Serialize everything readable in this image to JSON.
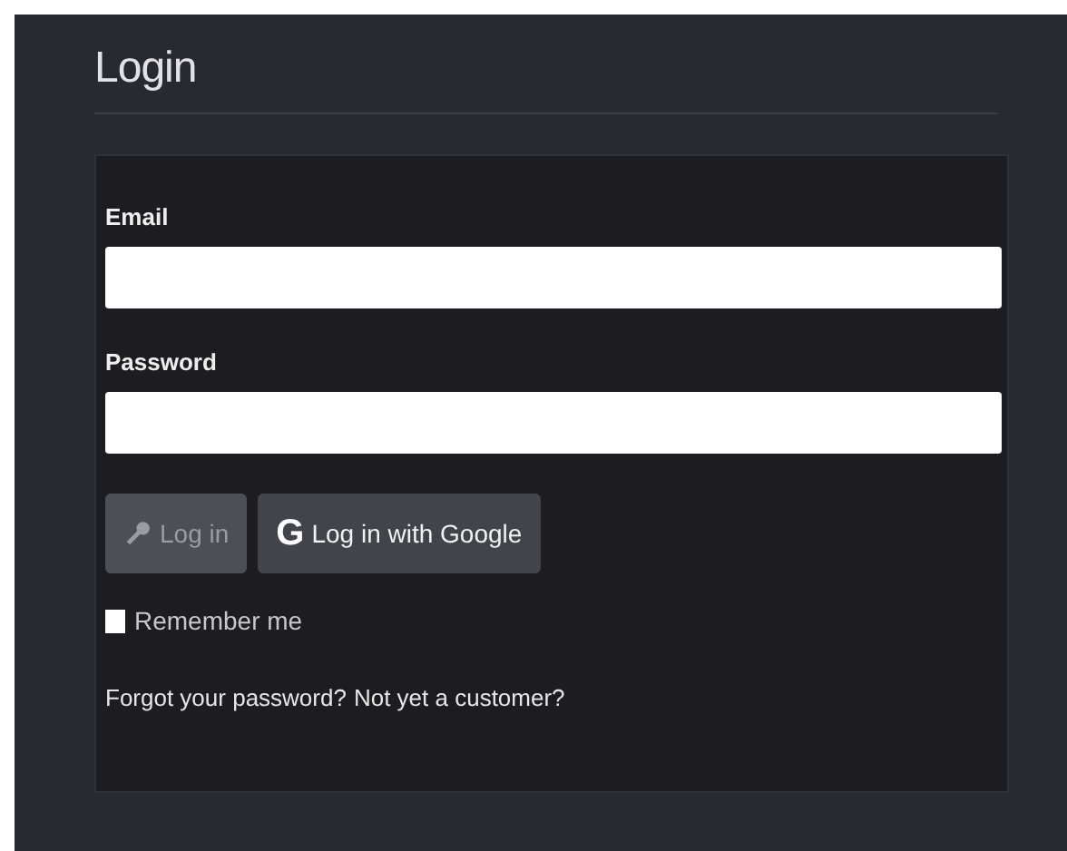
{
  "title": "Login",
  "fields": [
    {
      "label": "Email"
    },
    {
      "label": "Password"
    }
  ],
  "buttons": [
    {
      "label": "Log in",
      "kind": "key",
      "disabled": true
    },
    {
      "label": "Log in with Google",
      "kind": "google",
      "icon": "G",
      "disabled": false
    }
  ],
  "remember": {
    "label": "Remember me",
    "checked": false
  },
  "links": [
    {
      "label": "Forgot your password?"
    },
    {
      "label": "Not yet a customer?"
    }
  ]
}
